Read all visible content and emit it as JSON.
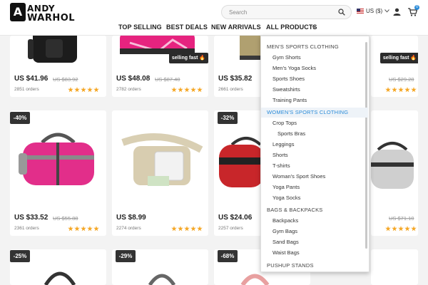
{
  "header": {
    "logo_line1": "ANDY",
    "logo_line2": "WARHOL",
    "logo_mark": "A",
    "search_placeholder": "Search",
    "currency": "US ($)",
    "cart_count": "0",
    "icons": [
      "search-icon",
      "flag-icon",
      "chevron-down-icon",
      "user-icon",
      "cart-icon"
    ]
  },
  "nav": {
    "items": [
      "TOP SELLING",
      "BEST DEALS",
      "NEW ARRIVALS",
      "ALL PRODUCTS"
    ]
  },
  "products": [
    {
      "price": "US $41.96",
      "old_price": "US $83.92",
      "orders": "2851 orders",
      "rating": 5
    },
    {
      "price": "US $48.08",
      "old_price": "US $87.40",
      "orders": "2782 orders",
      "rating": 5,
      "badge": "selling fast 🔥"
    },
    {
      "price": "US $35.82",
      "old_price": "",
      "orders": "2661 orders",
      "rating": 5
    },
    {
      "price": "",
      "old_price": "US $29.28",
      "orders": "",
      "rating": 5,
      "badge": "selling fast 🔥"
    },
    {
      "discount": "-40%",
      "price": "US $33.52",
      "old_price": "US $55.88",
      "orders": "2361 orders",
      "rating": 5
    },
    {
      "price": "US $8.99",
      "old_price": "",
      "orders": "2274 orders",
      "rating": 5
    },
    {
      "discount": "-32%",
      "price": "US $24.06",
      "old_price": "",
      "orders": "2257 orders",
      "rating": 5
    },
    {
      "price": "",
      "old_price": "US $71.10",
      "orders": "",
      "rating": 5
    },
    {
      "discount": "-25%"
    },
    {
      "discount": "-29%"
    },
    {
      "discount": "-68%"
    }
  ],
  "dropdown": {
    "items": [
      "MEN'S SPORTS CLOTHING",
      "Gym Shorts",
      "Men's Yoga Socks",
      "Sports Shoes",
      "Sweatshirts",
      "Training Pants",
      "WOMEN'S SPORTS CLOTHING",
      "Crop Tops",
      "Sports Bras",
      "Leggings",
      "Shorts",
      "T-shirts",
      "Woman's Sport Shoes",
      "Yoga Pants",
      "Yoga Socks",
      "BAGS & BACKPACKS",
      "Backpacks",
      "Gym Bags",
      "Sand Bags",
      "Waist Bags",
      "PUSHUP STANDS"
    ]
  },
  "colors": {
    "accent": "#2a8bd8",
    "star": "#f5a623",
    "badge_bg": "#333333",
    "page_bg": "#f3f3f3"
  }
}
